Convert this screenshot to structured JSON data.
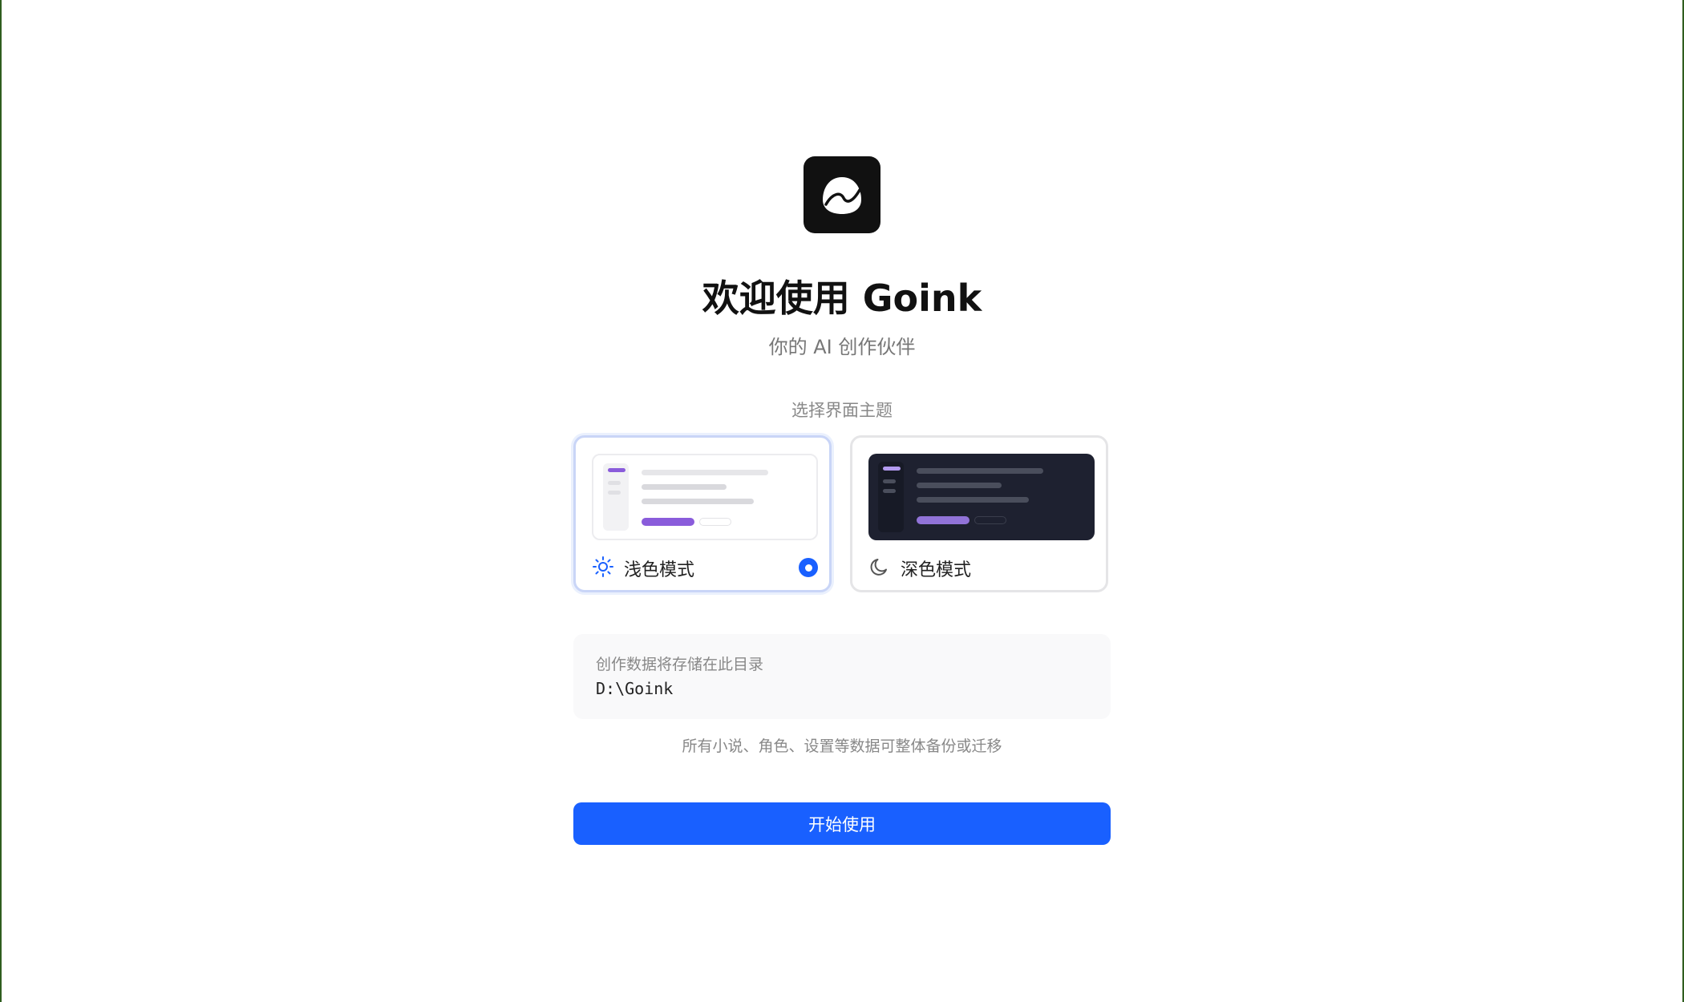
{
  "app": {
    "title": "欢迎使用 Goink",
    "subtitle": "你的 AI 创作伙伴"
  },
  "theme": {
    "section_label": "选择界面主题",
    "options": [
      {
        "label": "浅色模式",
        "icon": "sun-icon",
        "selected": true
      },
      {
        "label": "深色模式",
        "icon": "moon-icon",
        "selected": false
      }
    ]
  },
  "storage": {
    "label": "创作数据将存储在此目录",
    "path": "D:\\Goink",
    "note": "所有小说、角色、设置等数据可整体备份或迁移"
  },
  "actions": {
    "start_label": "开始使用"
  },
  "colors": {
    "accent": "#1960ff",
    "preview_accent": "#8a5cdb",
    "dark_preview_bg": "#1e2130"
  }
}
